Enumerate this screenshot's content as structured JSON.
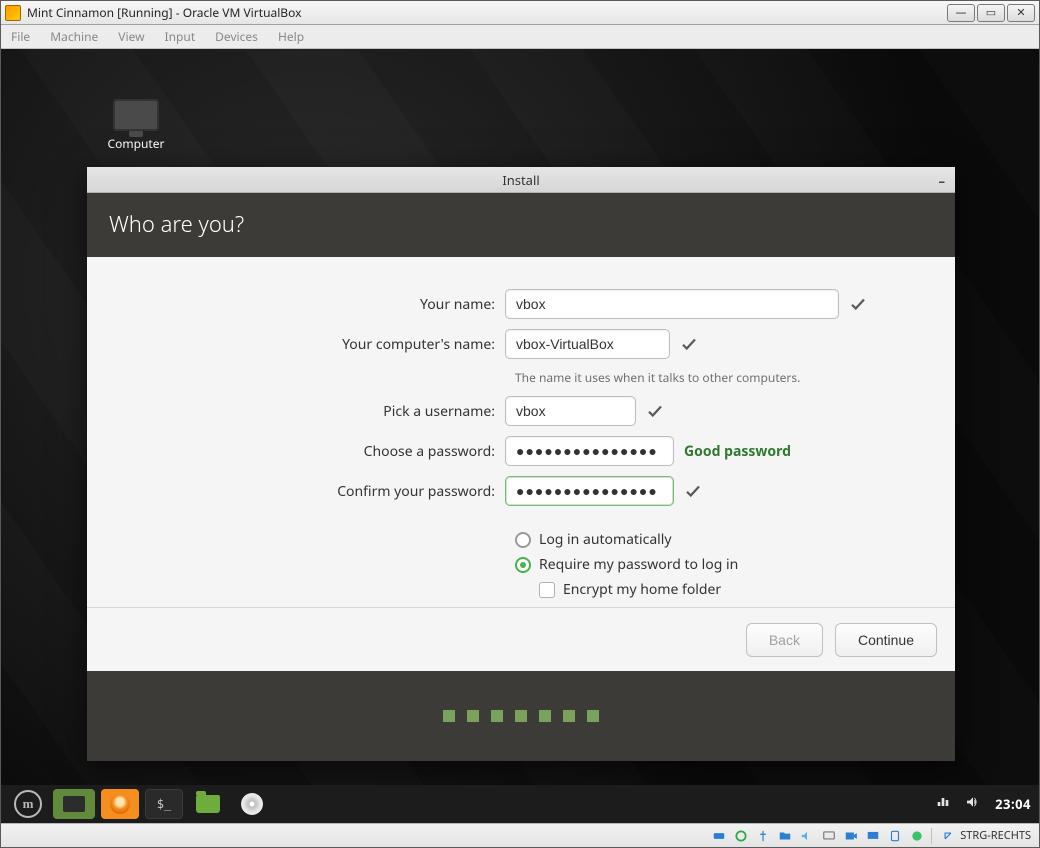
{
  "vbox": {
    "title": "Mint Cinnamon [Running] - Oracle VM VirtualBox",
    "menu": [
      "File",
      "Machine",
      "View",
      "Input",
      "Devices",
      "Help"
    ],
    "hostkey": "STRG-RECHTS"
  },
  "desktop": {
    "computer_label": "Computer"
  },
  "installer": {
    "window_title": "Install",
    "heading": "Who are you?",
    "labels": {
      "name": "Your name:",
      "hostname": "Your computer's name:",
      "hostname_hint": "The name it uses when it talks to other computers.",
      "username": "Pick a username:",
      "password": "Choose a password:",
      "confirm": "Confirm your password:"
    },
    "values": {
      "name": "vbox",
      "hostname": "vbox-VirtualBox",
      "username": "vbox",
      "password_mask": "●●●●●●●●●●●●●●●",
      "confirm_mask": "●●●●●●●●●●●●●●●"
    },
    "password_strength": "Good password",
    "options": {
      "auto_login": "Log in automatically",
      "require_pw": "Require my password to log in",
      "encrypt_home": "Encrypt my home folder",
      "selected": "require_pw",
      "encrypt_checked": false
    },
    "buttons": {
      "back": "Back",
      "continue": "Continue"
    },
    "progress_dots": 7
  },
  "taskbar": {
    "clock": "23:04"
  }
}
